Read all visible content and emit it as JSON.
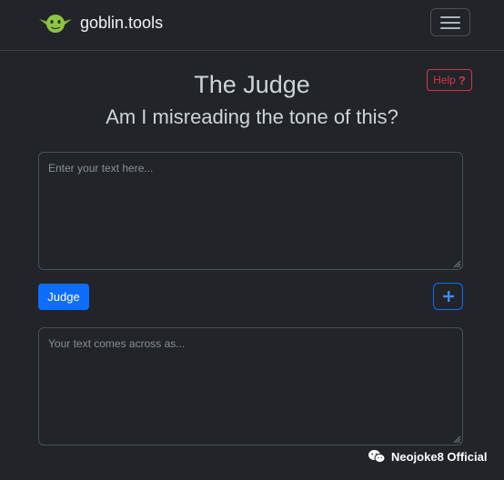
{
  "navbar": {
    "brand": "goblin.tools",
    "logo_icon": "goblin-head-icon",
    "menu_icon": "hamburger-menu-icon"
  },
  "page": {
    "title": "The Judge",
    "subtitle": "Am I misreading the tone of this?"
  },
  "help": {
    "label": "Help",
    "icon": "question-mark-icon"
  },
  "input": {
    "placeholder": "Enter your text here...",
    "value": ""
  },
  "actions": {
    "judge_label": "Judge",
    "add_icon": "plus-icon"
  },
  "output": {
    "placeholder": "Your text comes across as...",
    "value": ""
  },
  "watermark": {
    "text": "Neojoke8 Official",
    "icon": "wechat-icon"
  },
  "colors": {
    "background": "#212429",
    "primary": "#0d6efd",
    "danger": "#dc3545",
    "logo_green": "#8dc63f"
  }
}
